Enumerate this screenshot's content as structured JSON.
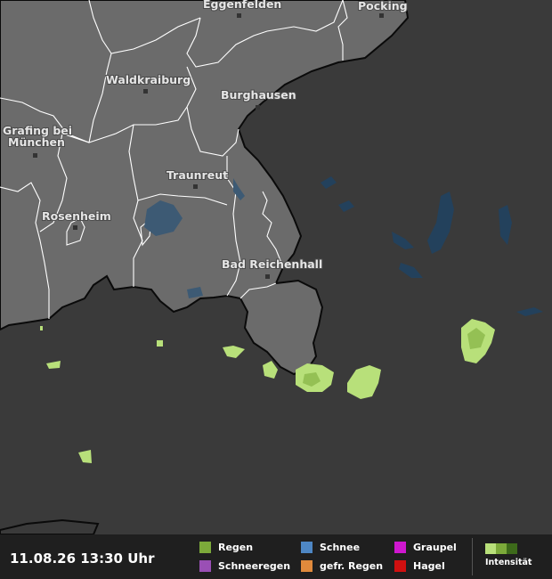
{
  "timestamp": "11.08.26 13:30 Uhr",
  "cities": [
    {
      "name": "Eggenfelden"
    },
    {
      "name": "Pocking"
    },
    {
      "name": "Waldkraiburg"
    },
    {
      "name": "Burghausen"
    },
    {
      "name": "Grafing bei"
    },
    {
      "name": "München"
    },
    {
      "name": "Traunreut"
    },
    {
      "name": "Rosenheim"
    },
    {
      "name": "Bad Reichenhall"
    }
  ],
  "legend": {
    "items": [
      {
        "label": "Regen",
        "color": "#7caa3a"
      },
      {
        "label": "Schneeregen",
        "color": "#9a4fb5"
      },
      {
        "label": "Schnee",
        "color": "#4e87c4"
      },
      {
        "label": "gefr. Regen",
        "color": "#e08a3c"
      },
      {
        "label": "Graupel",
        "color": "#cf17cf"
      },
      {
        "label": "Hagel",
        "color": "#d01010"
      }
    ],
    "intensity_label": "Intensität",
    "intensity_colors": [
      "#b8e07a",
      "#7caa3a",
      "#3d6a1a"
    ]
  },
  "colors": {
    "land": "#6b6b6b",
    "outside": "#3a3a3a",
    "water": "#23415c",
    "precip_light": "#b8e07a"
  }
}
